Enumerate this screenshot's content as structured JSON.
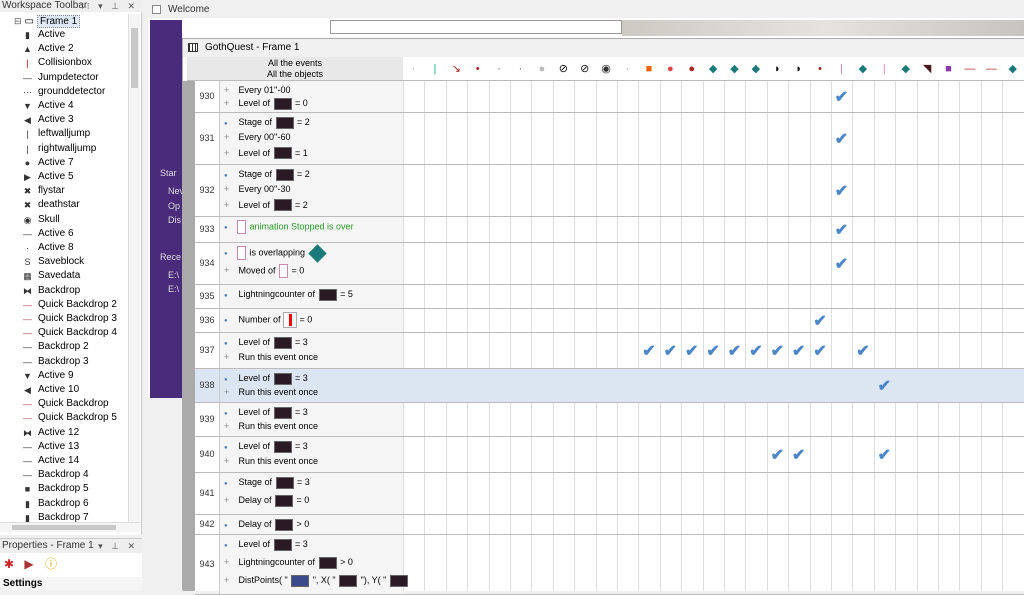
{
  "workspace": {
    "title": "Workspace Toolbar",
    "controls": "⁝⁝ ▾ ⊥ ✕",
    "frame_label": "Frame 1",
    "items": [
      {
        "label": "Active",
        "icon": "▮"
      },
      {
        "label": "Active 2",
        "icon": "▲"
      },
      {
        "label": "Collisionbox",
        "icon": "|"
      },
      {
        "label": "Jumpdetector",
        "icon": "—"
      },
      {
        "label": "grounddetector",
        "icon": "⋯"
      },
      {
        "label": "Active 4",
        "icon": "▼"
      },
      {
        "label": "Active 3",
        "icon": "◀"
      },
      {
        "label": "leftwalljump",
        "icon": "|"
      },
      {
        "label": "rightwalljump",
        "icon": "|"
      },
      {
        "label": "Active 7",
        "icon": "●"
      },
      {
        "label": "Active 5",
        "icon": "▶"
      },
      {
        "label": "flystar",
        "icon": "✖"
      },
      {
        "label": "deathstar",
        "icon": "✖"
      },
      {
        "label": "Skull",
        "icon": "◉"
      },
      {
        "label": "Active 6",
        "icon": "—"
      },
      {
        "label": "Active 8",
        "icon": "·"
      },
      {
        "label": "Saveblock",
        "icon": "S"
      },
      {
        "label": "Savedata",
        "icon": "▦"
      },
      {
        "label": "Backdrop",
        "icon": "⧓"
      },
      {
        "label": "Quick Backdrop 2",
        "icon": "—"
      },
      {
        "label": "Quick Backdrop 3",
        "icon": "—"
      },
      {
        "label": "Quick Backdrop 4",
        "icon": "—"
      },
      {
        "label": "Backdrop 2",
        "icon": "—"
      },
      {
        "label": "Backdrop 3",
        "icon": "—"
      },
      {
        "label": "Active 9",
        "icon": "▼"
      },
      {
        "label": "Active 10",
        "icon": "◀"
      },
      {
        "label": "Quick Backdrop",
        "icon": "—"
      },
      {
        "label": "Quick Backdrop 5",
        "icon": "—"
      },
      {
        "label": "Active 12",
        "icon": "⧓"
      },
      {
        "label": "Active 13",
        "icon": "—"
      },
      {
        "label": "Active 14",
        "icon": "—"
      },
      {
        "label": "Backdrop 4",
        "icon": "—"
      },
      {
        "label": "Backdrop 5",
        "icon": "■"
      },
      {
        "label": "Backdrop 6",
        "icon": "▮"
      },
      {
        "label": "Backdrop 7",
        "icon": "▮"
      }
    ]
  },
  "properties": {
    "title": "Properties - Frame 1",
    "controls": "▾ ⊥ ✕",
    "settings_label": "Settings"
  },
  "welcome": {
    "tab_label": "Welcome",
    "side_text": [
      "Star",
      "Nev",
      "Op",
      "Dis",
      "Rece",
      "E:\\",
      "E:\\"
    ]
  },
  "event_editor": {
    "title": "GothQuest - Frame 1",
    "header_line1": "All the events",
    "header_line2": "All the objects",
    "rows": [
      {
        "num": "930",
        "lines": [
          [
            "+",
            "Every 01''-00"
          ],
          [
            "+",
            "Level of",
            "obj",
            "= 0"
          ]
        ],
        "checks": [
          20
        ]
      },
      {
        "num": "931",
        "lines": [
          [
            "•",
            "Stage of",
            "obj",
            "= 2"
          ],
          [
            "+",
            "Every 00''-60"
          ],
          [
            "+",
            "Level of",
            "obj",
            "= 1"
          ]
        ],
        "checks": [
          20
        ]
      },
      {
        "num": "932",
        "lines": [
          [
            "•",
            "Stage of",
            "obj",
            "= 2"
          ],
          [
            "+",
            "Every 00''-30"
          ],
          [
            "+",
            "Level of",
            "obj",
            "= 2"
          ]
        ],
        "checks": [
          20
        ]
      },
      {
        "num": "933",
        "lines": [
          [
            "•",
            "objs",
            "animation Stopped is over"
          ]
        ],
        "checks": [
          20
        ]
      },
      {
        "num": "934",
        "lines": [
          [
            "•",
            "objs",
            "is overlapping",
            "objd"
          ],
          [
            "+",
            "Moved of",
            "objs",
            "= 0"
          ]
        ],
        "checks": [
          20
        ]
      },
      {
        "num": "935",
        "lines": [
          [
            "•",
            "Lightningcounter of",
            "obj",
            "= 5"
          ]
        ],
        "checks": []
      },
      {
        "num": "936",
        "lines": [
          [
            "•",
            "Number of",
            "objr",
            "= 0"
          ]
        ],
        "checks": [
          19
        ]
      },
      {
        "num": "937",
        "lines": [
          [
            "•",
            "Level of",
            "obj",
            "= 3"
          ],
          [
            "+",
            "Run this event once"
          ]
        ],
        "checks": [
          11,
          12,
          13,
          14,
          15,
          16,
          17,
          18,
          19,
          21
        ]
      },
      {
        "num": "938",
        "lines": [
          [
            "•",
            "Level of",
            "obj",
            "= 3"
          ],
          [
            "+",
            "Run this event once"
          ]
        ],
        "checks": [
          22
        ],
        "selected": true
      },
      {
        "num": "939",
        "lines": [
          [
            "•",
            "Level of",
            "obj",
            "= 3"
          ],
          [
            "+",
            "Run this event once"
          ]
        ],
        "checks": []
      },
      {
        "num": "940",
        "lines": [
          [
            "•",
            "Level of",
            "obj",
            "= 3"
          ],
          [
            "+",
            "Run this event once"
          ]
        ],
        "checks": [
          17,
          18,
          22
        ]
      },
      {
        "num": "941",
        "lines": [
          [
            "•",
            "Stage of",
            "obj",
            "= 3"
          ],
          [
            "+",
            "Delay of",
            "obj",
            "= 0"
          ]
        ],
        "checks": []
      },
      {
        "num": "942",
        "lines": [
          [
            "•",
            "Delay of",
            "obj",
            "> 0"
          ]
        ],
        "checks": []
      },
      {
        "num": "943",
        "lines": [
          [
            "•",
            "Level of",
            "obj",
            "= 3"
          ],
          [
            "+",
            "Lightningcounter of",
            "obj",
            "> 0"
          ],
          [
            "+",
            "DistPoints( \"",
            "objx",
            "\", X( \"",
            "obj",
            "\"), Y( \"",
            "obj"
          ]
        ],
        "checks": []
      }
    ],
    "column_icons": [
      "·",
      "|",
      "↘",
      "•",
      "·",
      "·",
      "●",
      "⊘",
      "⊘",
      "◉",
      "·",
      "■",
      "●",
      "●",
      "◆",
      "◆",
      "◆",
      "◗",
      "◗",
      "•",
      "|",
      "◆",
      "|",
      "◆",
      "◥",
      "■",
      "—",
      "—",
      "◆"
    ]
  }
}
